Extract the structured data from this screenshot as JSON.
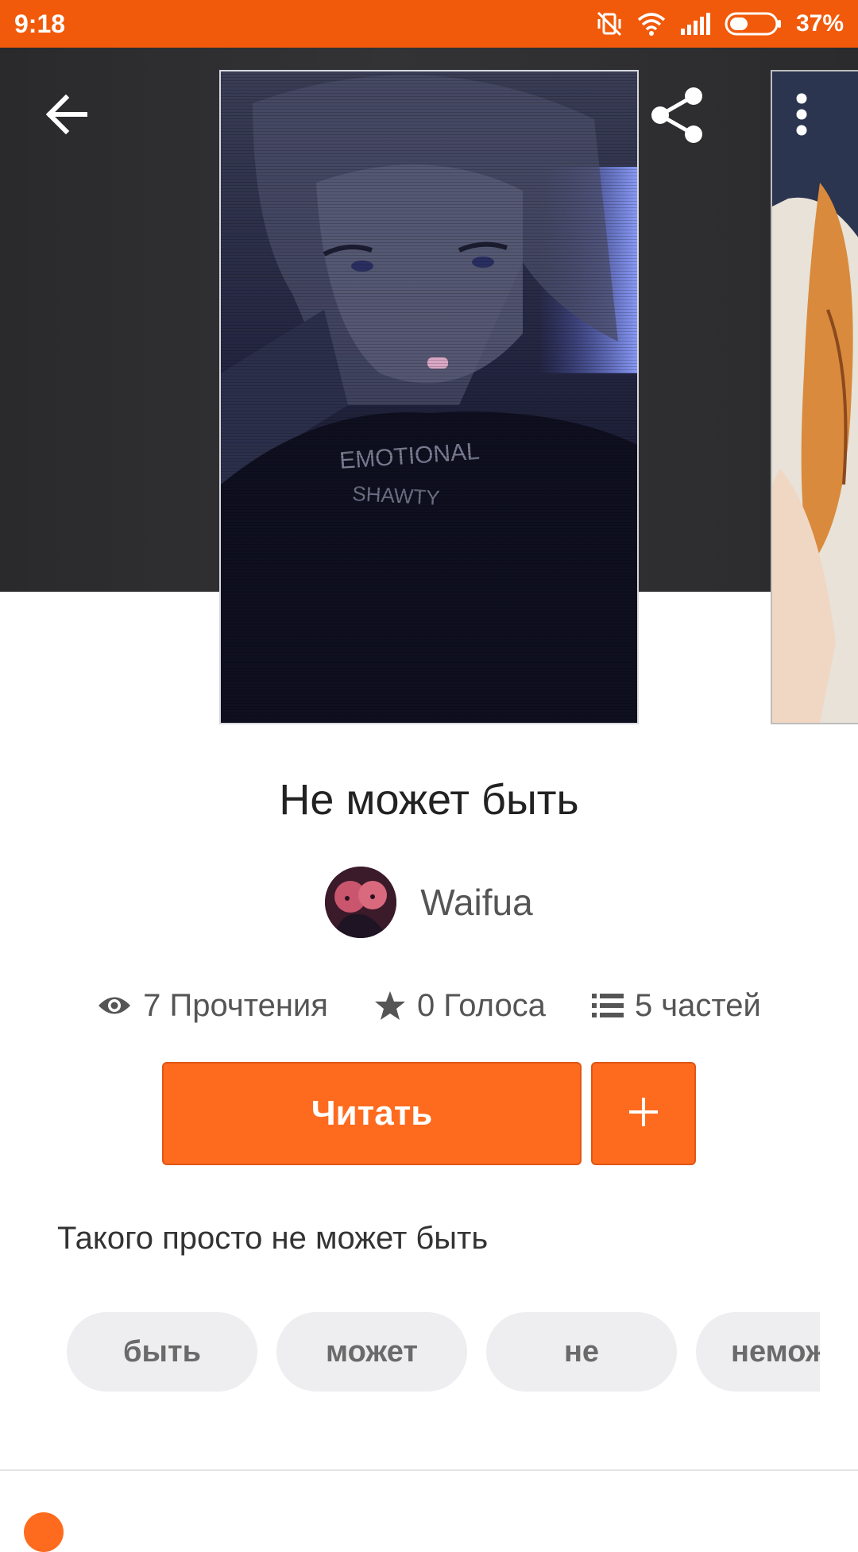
{
  "status_bar": {
    "time": "9:18",
    "battery": "37%",
    "icons": [
      "vibrate-off-icon",
      "wifi-icon",
      "signal-icon",
      "battery-icon"
    ]
  },
  "toolbar": {
    "back_icon": "arrow-left-icon",
    "share_icon": "share-icon",
    "more_icon": "more-vertical-icon"
  },
  "cover": {
    "shirt_text_line1": "EMOTIONAL",
    "shirt_text_line2": "SHAWTY"
  },
  "story": {
    "title": "Не может быть",
    "author": "Waifua",
    "description": "Такого просто не может быть"
  },
  "stats": {
    "reads": "7 Прочтения",
    "votes": "0 Голоса",
    "parts": "5 частей",
    "icons": [
      "eye-icon",
      "star-icon",
      "list-icon"
    ]
  },
  "actions": {
    "read_label": "Читать",
    "add_icon": "plus-icon"
  },
  "tags": [
    "быть",
    "может",
    "не",
    "немож"
  ],
  "colors": {
    "accent": "#f15a0a",
    "button": "#ff6b1e",
    "tag_bg": "#eeedf0",
    "hero_bg": "#2d2d2f"
  }
}
